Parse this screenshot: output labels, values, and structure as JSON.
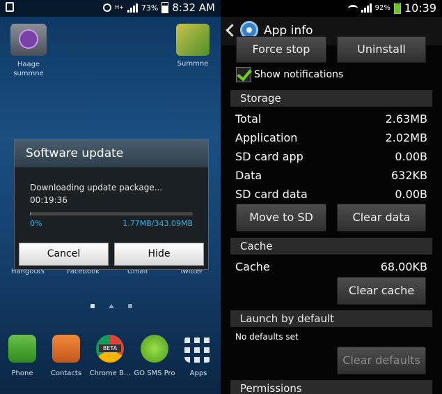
{
  "left": {
    "status": {
      "battery": "73%",
      "time": "8:32 AM"
    },
    "home_icons": {
      "folder_label": "Haage summne",
      "right_label": "Summne"
    },
    "dialog": {
      "title": "Software update",
      "message": "Downloading update package...",
      "elapsed": "00:19:36",
      "percent": "0%",
      "size": "1.77MB/343.09MB",
      "progress_fraction": 0.005,
      "cancel": "Cancel",
      "hide": "Hide"
    },
    "partial_labels": [
      "Hangouts",
      "Facebook",
      "Gmail",
      "Twitter"
    ],
    "dock": [
      "Phone",
      "Contacts",
      "Chrome B...",
      "GO SMS Pro",
      "Apps"
    ],
    "chrome_badge": "BETA"
  },
  "right": {
    "status": {
      "battery": "92%",
      "time": "10:39"
    },
    "title": "App info",
    "force_stop": "Force stop",
    "uninstall": "Uninstall",
    "show_notifications": "Show notifications",
    "storage_header": "Storage",
    "storage_rows": [
      {
        "label": "Total",
        "value": "2.63MB"
      },
      {
        "label": "Application",
        "value": "2.02MB"
      },
      {
        "label": "SD card app",
        "value": "0.00B"
      },
      {
        "label": "Data",
        "value": "632KB"
      },
      {
        "label": "SD card data",
        "value": "0.00B"
      }
    ],
    "move_to_sd": "Move to SD card",
    "clear_data": "Clear data",
    "cache_header": "Cache",
    "cache_row": {
      "label": "Cache",
      "value": "68.00KB"
    },
    "clear_cache": "Clear cache",
    "launch_header": "Launch by default",
    "no_defaults": "No defaults set",
    "clear_defaults": "Clear defaults",
    "permissions_header": "Permissions"
  }
}
